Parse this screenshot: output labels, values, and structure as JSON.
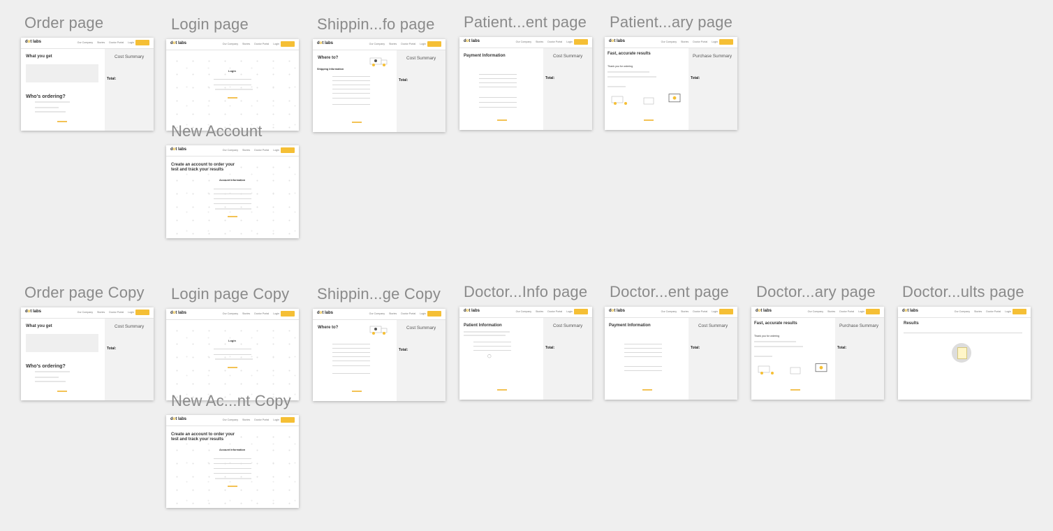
{
  "canvas_labels": {
    "order": "Order page",
    "login": "Login page",
    "shipping": "Shippin...fo page",
    "patient_payment": "Patient...ent page",
    "patient_summary": "Patient...ary page",
    "new_account": "New Account",
    "order_copy": "Order page Copy",
    "login_copy": "Login page Copy",
    "shipping_copy": "Shippin...ge Copy",
    "doctor_info": "Doctor...Info page",
    "doctor_payment": "Doctor...ent page",
    "doctor_summary": "Doctor...ary page",
    "doctor_results": "Doctor...ults page",
    "new_account_copy": "New Ac...nt Copy"
  },
  "site": {
    "logo_prefix": "d",
    "logo_dot": "o",
    "logo_suffix": "t labs",
    "nav": [
      "Our Company",
      "Stories",
      "Doctor Portal",
      "Login"
    ],
    "accent": "#f5bf35"
  },
  "screens": {
    "what_you_get": "What you get",
    "whos_ordering": "Who's ordering?",
    "cost_summary": "Cost Summary",
    "purchase_summary": "Purchase Summary",
    "total": "Total:",
    "login": "Login",
    "where_to": "Where to?",
    "shipping_info": "Shipping Information",
    "payment_info": "Payment Information",
    "patient_info": "Patient Information",
    "fast_results": "Fast, accurate results",
    "thank_you": "Thank you for ordering",
    "create_account_line1": "Create an account to order your",
    "create_account_line2": "test and track your results",
    "account_info": "Account Information",
    "results": "Results"
  }
}
